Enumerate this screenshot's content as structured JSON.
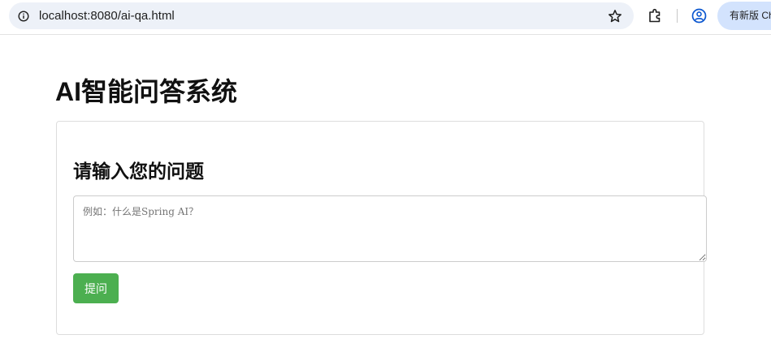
{
  "browser": {
    "url": "localhost:8080/ai-qa.html",
    "update_button_label": "有新版 Chrome"
  },
  "page": {
    "title": "AI智能问答系统"
  },
  "qa_form": {
    "heading": "请输入您的问题",
    "question_value": "",
    "question_placeholder": "例如：什么是Spring AI？",
    "submit_label": "提问",
    "submit_color": "#4caf50"
  },
  "icons": {
    "site_info": "info-icon",
    "bookmark": "star-icon",
    "extensions": "puzzle-icon",
    "profile": "profile-icon"
  }
}
